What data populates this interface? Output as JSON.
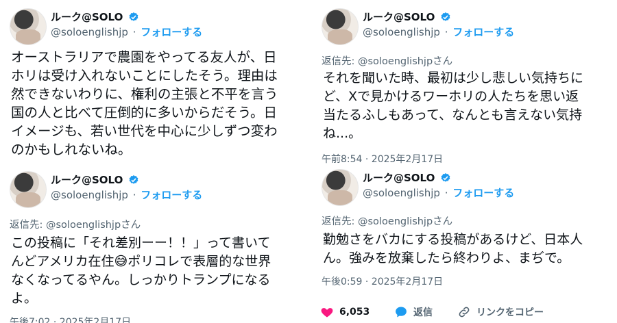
{
  "account": {
    "name": "ルーク@SOLO",
    "handle": "@soloenglishjp",
    "separator": "·",
    "follow_label": "フォローする"
  },
  "tweets": [
    {
      "lines": [
        "オーストラリアで農園をやってる友人が、日",
        "ホリは受け入れないことにしたそう。理由は",
        "然できないわりに、権利の主張と不平を言う",
        "国の人と比べて圧倒的に多いからだそう。日",
        "イメージも、若い世代を中心に少しずつ変わ",
        "のかもしれないね。"
      ]
    },
    {
      "reply_to": "返信先: @soloenglishjpさん",
      "lines": [
        "それを聞いた時、最初は少し悲しい気持ちに",
        "ど、Xで見かけるワーホリの人たちを思い返",
        "当たるふしもあって、なんとも言えない気持",
        "ね...。"
      ],
      "timestamp": "午前8:54 · 2025年2月17日"
    },
    {
      "reply_to": "返信先: @soloenglishjpさん",
      "lines": [
        "この投稿に「それ差別ーー！！」って書いて",
        "んどアメリカ在住😅ポリコレで表層的な世界",
        "なくなってるやん。しっかりトランプになる",
        "よ。"
      ],
      "timestamp": "午後7:02 · 2025年2月17日"
    },
    {
      "reply_to": "返信先: @soloenglishjpさん",
      "lines": [
        "勤勉さをバカにする投稿があるけど、日本人",
        "ん。強みを放棄したら終わりよ、まぢで。"
      ],
      "timestamp": "午後0:59 · 2025年2月17日",
      "actions": {
        "like_count": "6,053",
        "reply_label": "返信",
        "copy_link_label": "リンクをコピー"
      }
    }
  ],
  "colors": {
    "accent": "#1d9bf0",
    "like": "#f91880",
    "muted": "#536471"
  },
  "icons": [
    "verified-badge-icon",
    "heart-icon",
    "reply-bubble-icon",
    "link-icon"
  ]
}
